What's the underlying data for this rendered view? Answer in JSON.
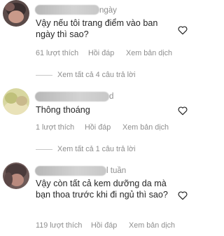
{
  "comments": [
    {
      "time": "ngày",
      "text": "Vậy nếu tôi trang điểm vào ban ngày thì sao?",
      "likes": "61 lượt thích",
      "reply_label": "Hồi đáp",
      "translate_label": "Xem bản dịch",
      "view_replies": "Xem tất cả 4 câu trả lời"
    },
    {
      "time": "d",
      "text": "Thông thoáng",
      "likes": "1 lượt thích",
      "reply_label": "Hồi đáp",
      "translate_label": "Xem bản dịch",
      "view_replies": "Xem tất cả 1 câu trả lời"
    },
    {
      "time": "l tuần",
      "text": "Vậy còn tất cả kem dưỡng da mà bạn thoa trước khi đi ngủ thì sao?",
      "likes": "119 lượt thích",
      "reply_label": "Hồi đáp",
      "translate_label": "Xem bản dịch"
    }
  ],
  "icons": {
    "like": "heart-outline-icon"
  }
}
